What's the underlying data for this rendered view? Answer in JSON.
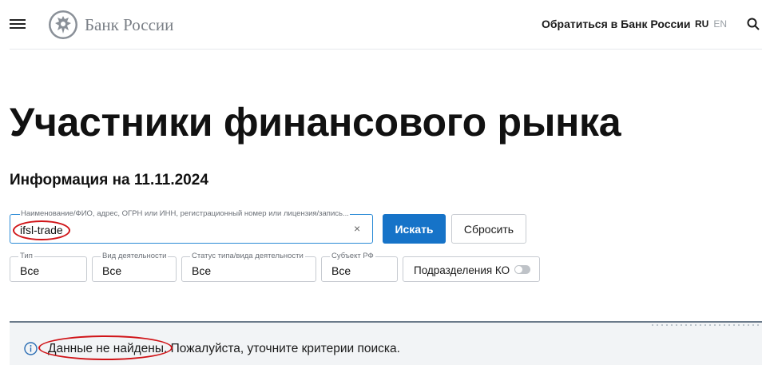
{
  "header": {
    "logo_text": "Банк России",
    "contact_link": "Обратиться в Банк России",
    "lang_ru": "RU",
    "lang_en": "EN",
    "icons": [
      "menu-icon",
      "bank-emblem-icon",
      "search-icon"
    ]
  },
  "page": {
    "title": "Участники финансового рынка",
    "info_date": "Информация на 11.11.2024"
  },
  "search": {
    "label": "Наименование/ФИО, адрес, ОГРН или ИНН, регистрационный номер или лицензия/запись...",
    "value": "ifsl-trade",
    "clear_symbol": "×",
    "search_button": "Искать",
    "reset_button": "Сбросить"
  },
  "filters": {
    "type": {
      "label": "Тип",
      "value": "Все"
    },
    "activity": {
      "label": "Вид деятельности",
      "value": "Все"
    },
    "status": {
      "label": "Статус типа/вида деятельности",
      "value": "Все"
    },
    "region": {
      "label": "Субъект РФ",
      "value": "Все"
    },
    "ko_toggle": {
      "label": "Подразделения КО",
      "enabled": false
    }
  },
  "notice": {
    "icon": "info-icon",
    "text": "Данные не найдены. Пожалуйста, уточните критерии поиска."
  },
  "colors": {
    "accent": "#1673c8",
    "focus_border": "#2a8ad6",
    "annotation": "#d01418",
    "notice_bg": "#f2f4f6"
  }
}
